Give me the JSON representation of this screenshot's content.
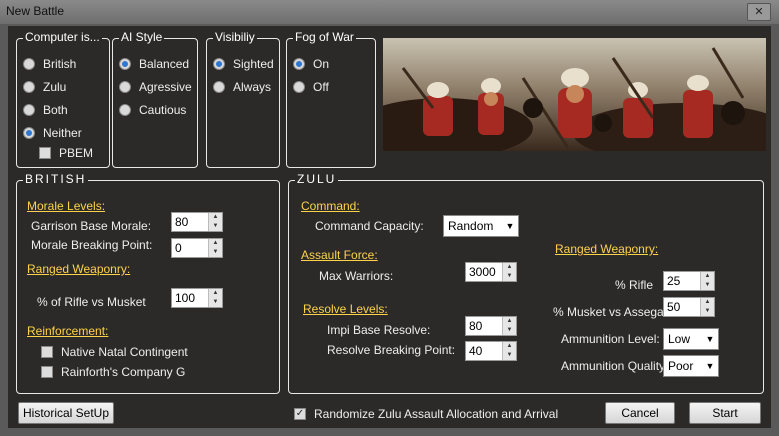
{
  "window": {
    "title": "New Battle",
    "close_label": "✕"
  },
  "computer_is": {
    "title": "Computer is...",
    "options": [
      "British",
      "Zulu",
      "Both",
      "Neither"
    ],
    "selected": "Neither",
    "pbem_label": "PBEM",
    "pbem_checked": false
  },
  "ai_style": {
    "title": "AI Style",
    "options": [
      "Balanced",
      "Agressive",
      "Cautious"
    ],
    "selected": "Balanced"
  },
  "visibility": {
    "title": "Visibiliy",
    "options": [
      "Sighted",
      "Always"
    ],
    "selected": "Sighted"
  },
  "fog_of_war": {
    "title": "Fog of War",
    "options": [
      "On",
      "Off"
    ],
    "selected": "On"
  },
  "british": {
    "title": "BRITISH",
    "morale_levels": "Morale Levels:",
    "garrison_base_morale_label": "Garrison Base Morale:",
    "garrison_base_morale": "80",
    "morale_breaking_point_label": "Morale Breaking Point:",
    "morale_breaking_point": "0",
    "ranged_weaponry": "Ranged Weaponry:",
    "rifle_vs_musket_label": "% of Rifle vs Musket",
    "rifle_vs_musket": "100",
    "reinforcement": "Reinforcement:",
    "native_natal_label": "Native Natal Contingent",
    "native_natal_checked": false,
    "rainforth_label": "Rainforth's Company G",
    "rainforth_checked": false
  },
  "zulu": {
    "title": "ZULU",
    "command": "Command:",
    "command_capacity_label": "Command Capacity:",
    "command_capacity": "Random",
    "assault_force": "Assault Force:",
    "max_warriors_label": "Max Warriors:",
    "max_warriors": "3000",
    "resolve_levels": "Resolve Levels:",
    "impi_base_resolve_label": "Impi Base Resolve:",
    "impi_base_resolve": "80",
    "resolve_breaking_point_label": "Resolve Breaking Point:",
    "resolve_breaking_point": "40",
    "ranged_weaponry": "Ranged Weaponry:",
    "rifle_label": "% Rifle",
    "rifle": "25",
    "musket_vs_assegai_label": "% Musket vs Assegai",
    "musket_vs_assegai": "50",
    "ammo_level_label": "Ammunition Level:",
    "ammo_level": "Low",
    "ammo_quality_label": "Ammunition Quality:",
    "ammo_quality": "Poor"
  },
  "footer": {
    "historical_setup": "Historical SetUp",
    "randomize_label": "Randomize Zulu Assault Allocation and Arrival",
    "randomize_checked": true,
    "cancel": "Cancel",
    "start": "Start"
  },
  "colors": {
    "accent": "#ffd24a",
    "background": "#2b2a28",
    "radio_selected": "#2f76d0"
  }
}
